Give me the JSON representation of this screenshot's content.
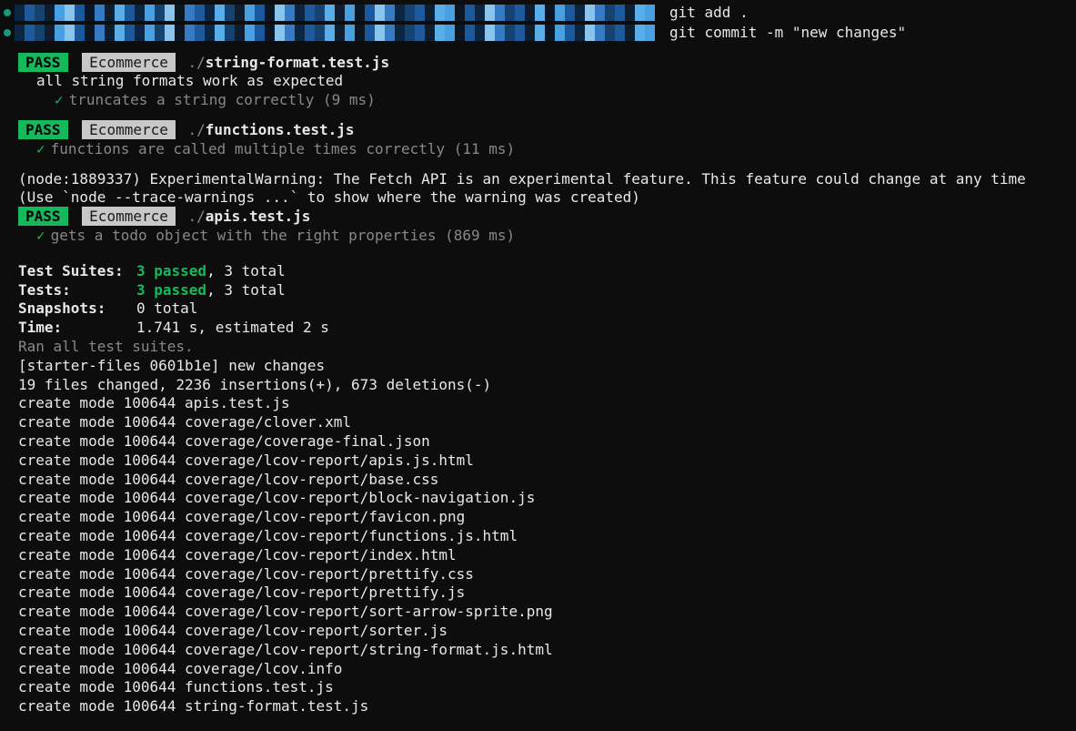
{
  "commands": {
    "cmd1": "git add .",
    "cmd2": "git commit -m \"new changes\""
  },
  "tests": [
    {
      "status": "PASS",
      "project": "Ecommerce",
      "pathPrefix": "./",
      "file": "string-format.test.js",
      "describe": "all string formats work as expected",
      "checks": [
        {
          "text": "truncates a string correctly (9 ms)"
        }
      ]
    },
    {
      "status": "PASS",
      "project": "Ecommerce",
      "pathPrefix": "./",
      "file": "functions.test.js",
      "describe": "",
      "checks": [
        {
          "text": "functions are called multiple times correctly (11 ms)"
        }
      ]
    },
    {
      "status": "PASS",
      "project": "Ecommerce",
      "pathPrefix": "./",
      "file": "apis.test.js",
      "describe": "",
      "checks": [
        {
          "text": "gets a todo object with the right properties (869 ms)"
        }
      ]
    }
  ],
  "warnings": {
    "line1": "(node:1889337) ExperimentalWarning: The Fetch API is an experimental feature. This feature could change at any time",
    "line2": "(Use `node --trace-warnings ...` to show where the warning was created)"
  },
  "summary": {
    "suitesLabel": "Test Suites:",
    "suitesPassed": "3 passed",
    "suitesTotal": ", 3 total",
    "testsLabel": "Tests:",
    "testsPassed": "3 passed",
    "testsTotal": ", 3 total",
    "snapshotsLabel": "Snapshots:",
    "snapshotsValue": "0 total",
    "timeLabel": "Time:",
    "timeValue": "1.741 s, estimated 2 s",
    "ranMessage": "Ran all test suites."
  },
  "gitOutput": {
    "commitLine": "[starter-files 0601b1e] new changes",
    "statsLine": " 19 files changed, 2236 insertions(+), 673 deletions(-)",
    "files": [
      " create mode 100644 apis.test.js",
      " create mode 100644 coverage/clover.xml",
      " create mode 100644 coverage/coverage-final.json",
      " create mode 100644 coverage/lcov-report/apis.js.html",
      " create mode 100644 coverage/lcov-report/base.css",
      " create mode 100644 coverage/lcov-report/block-navigation.js",
      " create mode 100644 coverage/lcov-report/favicon.png",
      " create mode 100644 coverage/lcov-report/functions.js.html",
      " create mode 100644 coverage/lcov-report/index.html",
      " create mode 100644 coverage/lcov-report/prettify.css",
      " create mode 100644 coverage/lcov-report/prettify.js",
      " create mode 100644 coverage/lcov-report/sort-arrow-sprite.png",
      " create mode 100644 coverage/lcov-report/sorter.js",
      " create mode 100644 coverage/lcov-report/string-format.js.html",
      " create mode 100644 coverage/lcov.info",
      " create mode 100644 functions.test.js",
      " create mode 100644 string-format.test.js"
    ]
  },
  "checkSymbol": "✓"
}
